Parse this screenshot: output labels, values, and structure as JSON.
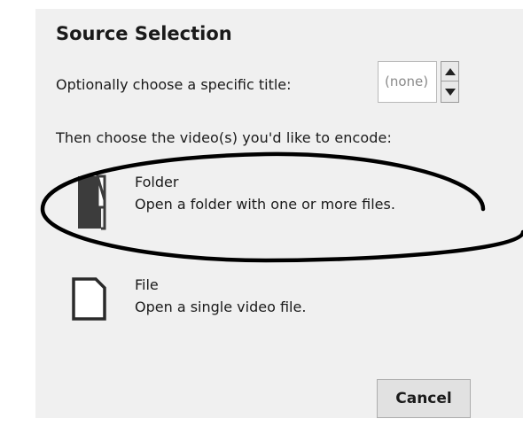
{
  "dialog": {
    "heading": "Source Selection",
    "title_label": "Optionally choose a specific title:",
    "title_value": "(none)",
    "prompt": "Then choose the video(s) you'd like to encode:"
  },
  "options": [
    {
      "icon": "folder-icon",
      "title": "Folder",
      "description": "Open a folder with one or more files."
    },
    {
      "icon": "file-icon",
      "title": "File",
      "description": "Open a single video file."
    }
  ],
  "buttons": {
    "cancel": "Cancel"
  },
  "colors": {
    "annotation": "#000000",
    "panel": "#f0f0f0"
  }
}
